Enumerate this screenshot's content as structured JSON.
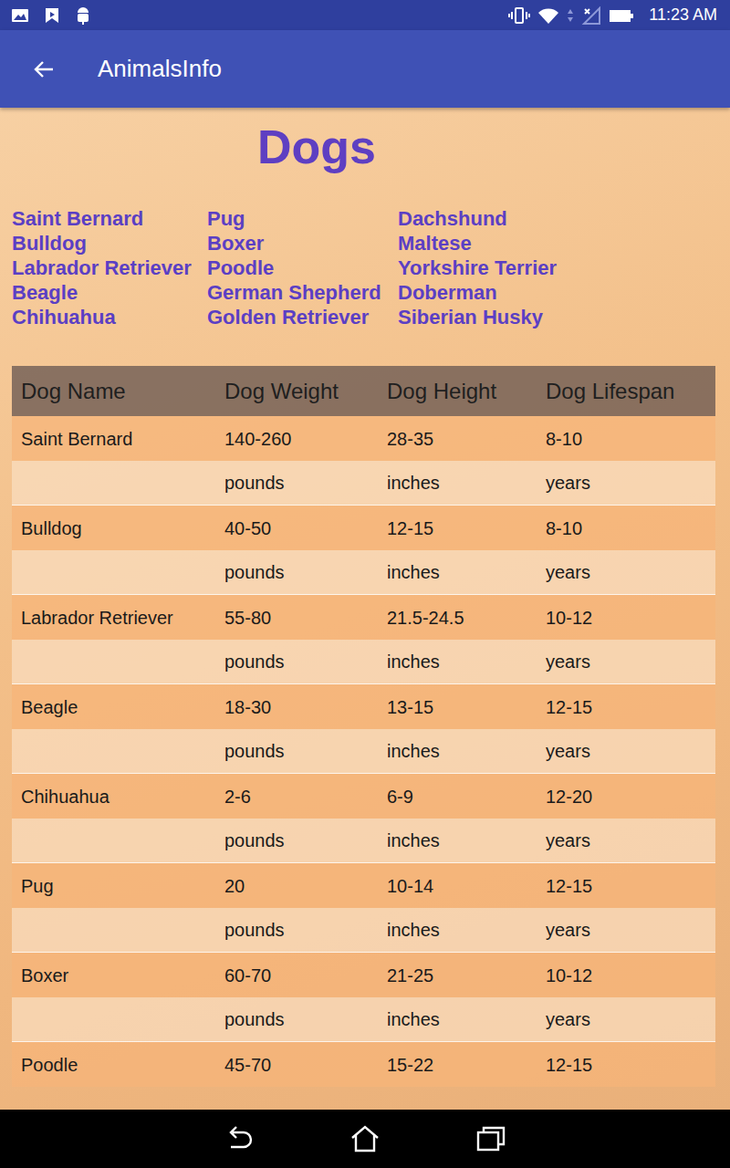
{
  "status_bar": {
    "time": "11:23 AM"
  },
  "app_bar": {
    "title": "AnimalsInfo"
  },
  "heading": "Dogs",
  "breed_links": [
    [
      "Saint Bernard",
      "Bulldog",
      "Labrador Retriever",
      "Beagle",
      "Chihuahua"
    ],
    [
      "Pug",
      "Boxer",
      "Poodle",
      "German Shepherd",
      "Golden Retriever"
    ],
    [
      "Dachshund",
      "Maltese",
      "Yorkshire Terrier",
      "Doberman",
      "Siberian Husky"
    ]
  ],
  "table": {
    "columns": [
      "Dog Name",
      "Dog Weight",
      "Dog Height",
      "Dog Lifespan"
    ],
    "rows": [
      {
        "cells": [
          "Saint Bernard",
          "140-260",
          "28-35",
          "8-10"
        ],
        "units": [
          "pounds",
          "inches",
          "years"
        ]
      },
      {
        "cells": [
          "Bulldog",
          "40-50",
          "12-15",
          "8-10"
        ],
        "units": [
          "pounds",
          "inches",
          "years"
        ]
      },
      {
        "cells": [
          "Labrador Retriever",
          "55-80",
          "21.5-24.5",
          "10-12"
        ],
        "units": [
          "pounds",
          "inches",
          "years"
        ]
      },
      {
        "cells": [
          "Beagle",
          "18-30",
          "13-15",
          "12-15"
        ],
        "units": [
          "pounds",
          "inches",
          "years"
        ]
      },
      {
        "cells": [
          "Chihuahua",
          "2-6",
          "6-9",
          "12-20"
        ],
        "units": [
          "pounds",
          "inches",
          "years"
        ]
      },
      {
        "cells": [
          "Pug",
          "20",
          "10-14",
          "12-15"
        ],
        "units": [
          "pounds",
          "inches",
          "years"
        ]
      },
      {
        "cells": [
          "Boxer",
          "60-70",
          "21-25",
          "10-12"
        ],
        "units": [
          "pounds",
          "inches",
          "years"
        ]
      },
      {
        "cells": [
          "Poodle",
          "45-70",
          "15-22",
          "12-15"
        ],
        "units": []
      }
    ]
  }
}
